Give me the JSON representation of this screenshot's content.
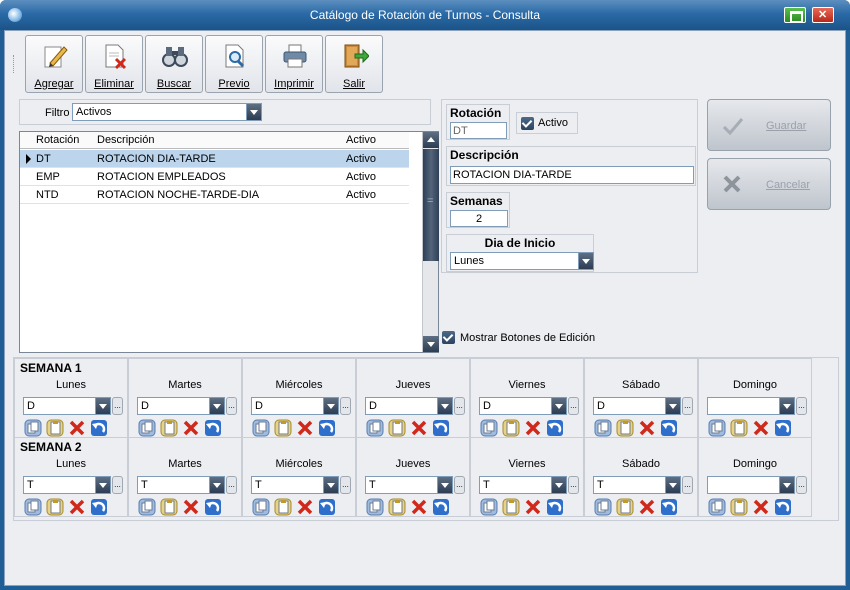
{
  "window": {
    "title": "Catálogo de Rotación de Turnos - Consulta"
  },
  "toolbar": {
    "buttons": [
      {
        "label": "Agregar",
        "icon": "pencil-icon"
      },
      {
        "label": "Eliminar",
        "icon": "delete-document-icon"
      },
      {
        "label": "Buscar",
        "icon": "binoculars-icon"
      },
      {
        "label": "Previo",
        "icon": "preview-icon"
      },
      {
        "label": "Imprimir",
        "icon": "printer-icon"
      },
      {
        "label": "Salir",
        "icon": "exit-door-icon"
      }
    ]
  },
  "filter": {
    "label": "Filtro",
    "value": "Activos"
  },
  "grid": {
    "columns": [
      "Rotación",
      "Descripción",
      "Activo"
    ],
    "rows": [
      {
        "rotacion": "DT",
        "descripcion": "ROTACION DIA-TARDE",
        "activo": "Activo",
        "selected": true
      },
      {
        "rotacion": "EMP",
        "descripcion": "ROTACION EMPLEADOS",
        "activo": "Activo",
        "selected": false
      },
      {
        "rotacion": "NTD",
        "descripcion": "ROTACION NOCHE-TARDE-DIA",
        "activo": "Activo",
        "selected": false
      }
    ]
  },
  "detail": {
    "rotacion_label": "Rotación",
    "rotacion_value": "DT",
    "activo_label": "Activo",
    "activo_checked": true,
    "descripcion_label": "Descripción",
    "descripcion_value": "ROTACION DIA-TARDE",
    "semanas_label": "Semanas",
    "semanas_value": "2",
    "inicio_label": "Dia de Inicio",
    "inicio_value": "Lunes"
  },
  "actions": {
    "guardar": "Guardar",
    "cancelar": "Cancelar"
  },
  "mostrar": {
    "label": "Mostrar Botones de Edición",
    "checked": true
  },
  "days": [
    "Lunes",
    "Martes",
    "Miércoles",
    "Jueves",
    "Viernes",
    "Sábado",
    "Domingo"
  ],
  "weeks": [
    {
      "title": "SEMANA 1",
      "values": [
        "D",
        "D",
        "D",
        "D",
        "D",
        "D",
        ""
      ]
    },
    {
      "title": "SEMANA 2",
      "values": [
        "T",
        "T",
        "T",
        "T",
        "T",
        "T",
        ""
      ]
    }
  ],
  "colors": {
    "titlebar": "#2a6aa6",
    "selected_row": "#bcd5ec",
    "panel": "#eceef2"
  }
}
